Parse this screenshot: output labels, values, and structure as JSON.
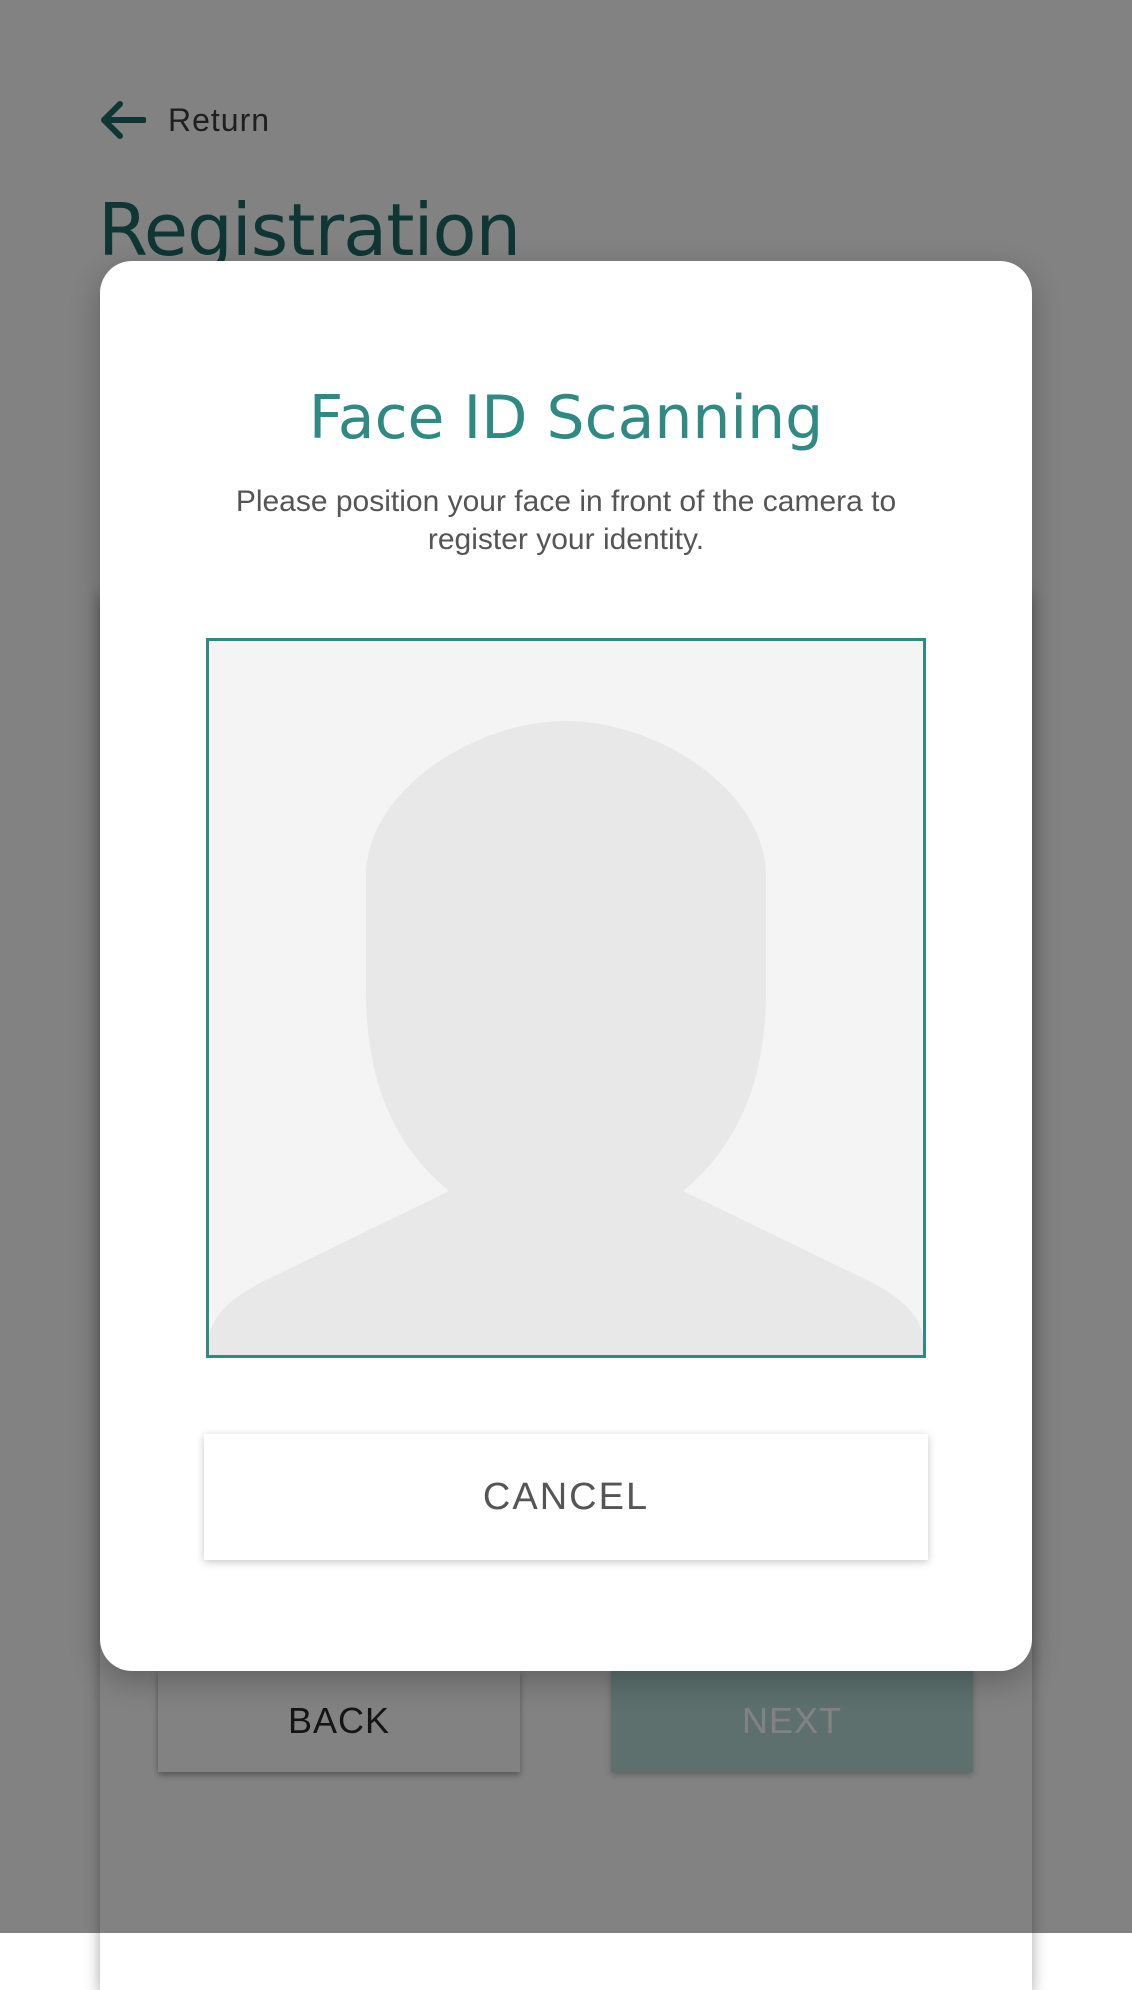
{
  "header": {
    "return_label": "Return",
    "return_icon": "arrow-left-icon",
    "page_title": "Registration"
  },
  "footer_buttons": {
    "back_label": "BACK",
    "next_label": "NEXT"
  },
  "modal": {
    "title": "Face ID Scanning",
    "description": "Please position your face in front of the camera to register your identity.",
    "placeholder_icon": "person-silhouette-icon",
    "cancel_label": "CANCEL"
  },
  "colors": {
    "accent": "#2f8a84",
    "title_dark": "#1f6b66",
    "overlay": "rgba(0,0,0,0.49)",
    "next_disabled": "#b7dcd8"
  }
}
